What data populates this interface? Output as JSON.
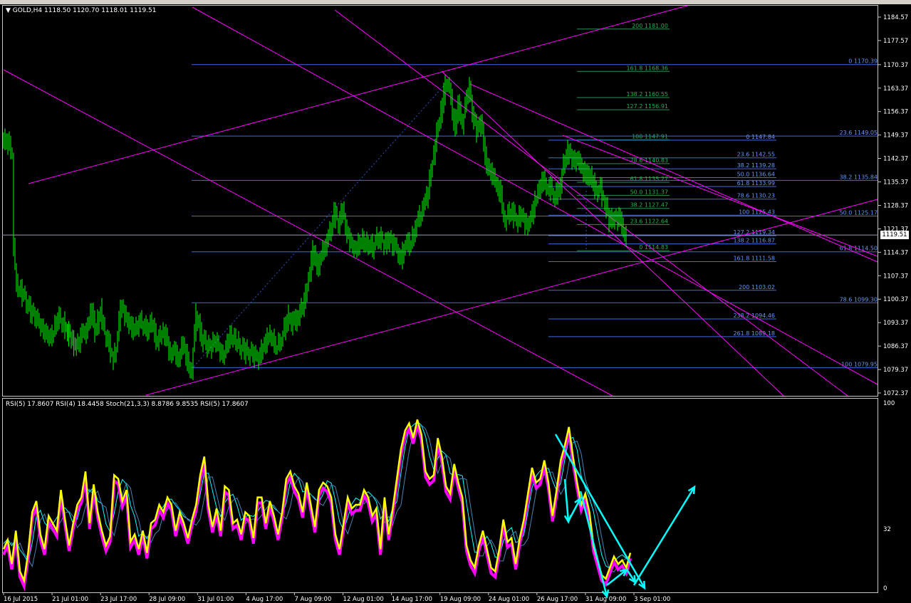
{
  "chart_header": {
    "symbol": "GOLD,H4",
    "ohlc": "1118.50 1120.70 1118.01 1119.51"
  },
  "indicator_header": "RSI(5) 17.8607  RSI(4) 18.4458  Stoch(21,3,3) 8.8786 9.8535  RSI(5) 17.8607",
  "current_price_label": "1119.51",
  "colors": {
    "background": "#000000",
    "candles": "#00ff00",
    "fib_lines": "#4169e1",
    "fib_labels_blue": "#6495ed",
    "fib_labels_green": "#22b14c",
    "trendlines": "#ff00ff",
    "rsi5": "#ff00ff",
    "rsi4": "#ffff00",
    "stoch_main": "#00ffff",
    "arrows": "#00ffff"
  },
  "chart_data": {
    "type": "candlestick",
    "timeframe": "H4",
    "symbol": "GOLD",
    "y_tick_labels": [
      "1184.57",
      "1177.57",
      "1170.37",
      "1163.37",
      "1156.37",
      "1149.37",
      "1142.37",
      "1135.37",
      "1128.37",
      "1121.37",
      "1114.37",
      "1107.37",
      "1100.37",
      "1093.37",
      "1086.37",
      "1079.37",
      "1072.37"
    ],
    "ylim": [
      1072.37,
      1184.57
    ],
    "x_tick_labels": [
      "16 Jul 2015",
      "21 Jul 01:00",
      "23 Jul 17:00",
      "28 Jul 09:00",
      "31 Jul 01:00",
      "4 Aug 17:00",
      "7 Aug 09:00",
      "12 Aug 01:00",
      "14 Aug 17:00",
      "19 Aug 09:00",
      "24 Aug 01:00",
      "26 Aug 17:00",
      "31 Aug 09:00",
      "3 Sep 01:00"
    ],
    "price_path": [
      [
        0,
        1148
      ],
      [
        8,
        1147
      ],
      [
        14,
        1144
      ],
      [
        16,
        1115
      ],
      [
        20,
        1105
      ],
      [
        30,
        1101
      ],
      [
        40,
        1097
      ],
      [
        50,
        1094
      ],
      [
        60,
        1090
      ],
      [
        70,
        1089
      ],
      [
        78,
        1095
      ],
      [
        86,
        1093
      ],
      [
        95,
        1089
      ],
      [
        104,
        1086
      ],
      [
        112,
        1090
      ],
      [
        118,
        1091
      ],
      [
        126,
        1097
      ],
      [
        130,
        1090
      ],
      [
        138,
        1097
      ],
      [
        142,
        1092
      ],
      [
        148,
        1088
      ],
      [
        156,
        1082
      ],
      [
        160,
        1086
      ],
      [
        166,
        1098
      ],
      [
        172,
        1096
      ],
      [
        178,
        1093
      ],
      [
        186,
        1091
      ],
      [
        194,
        1094
      ],
      [
        202,
        1091
      ],
      [
        210,
        1093
      ],
      [
        218,
        1087
      ],
      [
        224,
        1091
      ],
      [
        230,
        1089
      ],
      [
        236,
        1084
      ],
      [
        242,
        1085
      ],
      [
        248,
        1082
      ],
      [
        254,
        1088
      ],
      [
        260,
        1081
      ],
      [
        266,
        1079
      ],
      [
        272,
        1096
      ],
      [
        280,
        1089
      ],
      [
        290,
        1086
      ],
      [
        300,
        1088
      ],
      [
        310,
        1083
      ],
      [
        320,
        1090
      ],
      [
        330,
        1087
      ],
      [
        340,
        1085
      ],
      [
        350,
        1084
      ],
      [
        360,
        1083
      ],
      [
        368,
        1087
      ],
      [
        376,
        1090
      ],
      [
        384,
        1086
      ],
      [
        392,
        1088
      ],
      [
        400,
        1095
      ],
      [
        410,
        1093
      ],
      [
        418,
        1096
      ],
      [
        424,
        1100
      ],
      [
        430,
        1106
      ],
      [
        436,
        1115
      ],
      [
        442,
        1110
      ],
      [
        448,
        1113
      ],
      [
        454,
        1117
      ],
      [
        460,
        1120
      ],
      [
        466,
        1126
      ],
      [
        472,
        1123
      ],
      [
        478,
        1127
      ],
      [
        484,
        1120
      ],
      [
        490,
        1117
      ],
      [
        496,
        1115
      ],
      [
        504,
        1118
      ],
      [
        512,
        1117
      ],
      [
        520,
        1116
      ],
      [
        528,
        1119
      ],
      [
        536,
        1117
      ],
      [
        544,
        1118
      ],
      [
        552,
        1116
      ],
      [
        560,
        1112
      ],
      [
        566,
        1117
      ],
      [
        574,
        1117
      ],
      [
        580,
        1122
      ],
      [
        586,
        1125
      ],
      [
        592,
        1128
      ],
      [
        598,
        1133
      ],
      [
        604,
        1141
      ],
      [
        610,
        1150
      ],
      [
        616,
        1156
      ],
      [
        620,
        1162
      ],
      [
        624,
        1165
      ],
      [
        628,
        1164
      ],
      [
        632,
        1156
      ],
      [
        636,
        1151
      ],
      [
        640,
        1158
      ],
      [
        646,
        1153
      ],
      [
        652,
        1160
      ],
      [
        656,
        1164
      ],
      [
        660,
        1157
      ],
      [
        666,
        1150
      ],
      [
        672,
        1154
      ],
      [
        676,
        1147
      ],
      [
        680,
        1140
      ],
      [
        684,
        1139
      ],
      [
        688,
        1137
      ],
      [
        694,
        1135
      ],
      [
        700,
        1131
      ],
      [
        706,
        1123
      ],
      [
        712,
        1127
      ],
      [
        718,
        1125
      ],
      [
        724,
        1124
      ],
      [
        730,
        1126
      ],
      [
        736,
        1122
      ],
      [
        740,
        1123
      ],
      [
        746,
        1128
      ],
      [
        752,
        1132
      ],
      [
        758,
        1136
      ],
      [
        764,
        1134
      ],
      [
        770,
        1133
      ],
      [
        776,
        1131
      ],
      [
        782,
        1133
      ],
      [
        788,
        1140
      ],
      [
        794,
        1145
      ],
      [
        800,
        1142
      ],
      [
        806,
        1142
      ],
      [
        812,
        1141
      ],
      [
        818,
        1137
      ],
      [
        824,
        1138
      ],
      [
        828,
        1135
      ],
      [
        834,
        1133
      ],
      [
        840,
        1133
      ],
      [
        846,
        1129
      ],
      [
        852,
        1124
      ],
      [
        856,
        1125
      ],
      [
        862,
        1124
      ],
      [
        868,
        1125
      ],
      [
        872,
        1120
      ],
      [
        876,
        1119
      ]
    ],
    "fib_levels": [
      {
        "label": "200 1181.00",
        "price": 1181.0,
        "color": "green"
      },
      {
        "label": "161.8 1168.36",
        "price": 1168.36,
        "color": "green"
      },
      {
        "label": "138.2 1160.55",
        "price": 1160.55,
        "color": "green"
      },
      {
        "label": "127.2 1156.91",
        "price": 1156.91,
        "color": "green"
      },
      {
        "label": "100 1147.91",
        "price": 1147.91,
        "color": "green"
      },
      {
        "label": "78.6 1140.83",
        "price": 1140.83,
        "color": "green"
      },
      {
        "label": "61.8 1135.27",
        "price": 1135.27,
        "color": "green"
      },
      {
        "label": "50.0 1131.37",
        "price": 1131.37,
        "color": "green"
      },
      {
        "label": "38.2 1127.47",
        "price": 1127.47,
        "color": "green"
      },
      {
        "label": "23.6 1122.64",
        "price": 1122.64,
        "color": "green"
      },
      {
        "label": "0 1114.83",
        "price": 1114.83,
        "color": "green"
      },
      {
        "label": "0 1170.39",
        "price": 1170.39,
        "color": "blue"
      },
      {
        "label": "23.6 1149.05",
        "price": 1149.05,
        "color": "blue"
      },
      {
        "label": "38.2 1135.84",
        "price": 1135.84,
        "color": "blue"
      },
      {
        "label": "50.0 1125.17",
        "price": 1125.17,
        "color": "blue"
      },
      {
        "label": "61.8 1114.50",
        "price": 1114.5,
        "color": "blue"
      },
      {
        "label": "78.6 1099.30",
        "price": 1099.3,
        "color": "blue"
      },
      {
        "label": "100 1079.95",
        "price": 1079.95,
        "color": "blue"
      },
      {
        "label": "0 1147.84",
        "price": 1147.84,
        "color": "blue"
      },
      {
        "label": "23.6 1142.55",
        "price": 1142.55,
        "color": "blue"
      },
      {
        "label": "38.2 1139.28",
        "price": 1139.28,
        "color": "blue"
      },
      {
        "label": "50.0 1136.64",
        "price": 1136.64,
        "color": "blue"
      },
      {
        "label": "61.8 1133.99",
        "price": 1133.99,
        "color": "blue"
      },
      {
        "label": "78.6 1130.23",
        "price": 1130.23,
        "color": "blue"
      },
      {
        "label": "100 1125.43",
        "price": 1125.43,
        "color": "blue"
      },
      {
        "label": "127.2 1119.34",
        "price": 1119.34,
        "color": "blue"
      },
      {
        "label": "138.2 1116.87",
        "price": 1116.87,
        "color": "blue"
      },
      {
        "label": "161.8 1111.58",
        "price": 1111.58,
        "color": "blue"
      },
      {
        "label": "200 1103.02",
        "price": 1103.02,
        "color": "blue"
      },
      {
        "label": "238.2 1094.46",
        "price": 1094.46,
        "color": "blue"
      },
      {
        "label": "261.8 1089.18",
        "price": 1089.18,
        "color": "blue"
      }
    ],
    "indicator": {
      "y_tick_labels": [
        "100",
        "32",
        "0"
      ],
      "ylim": [
        0,
        100
      ],
      "series": [
        {
          "name": "RSI(5)",
          "color": "#ff00ff"
        },
        {
          "name": "RSI(4)",
          "color": "#ffff00"
        },
        {
          "name": "Stoch(21,3,3)",
          "color": "#00ffff"
        }
      ],
      "rsi_values": [
        20,
        25,
        12,
        30,
        8,
        3,
        18,
        40,
        46,
        28,
        20,
        38,
        34,
        30,
        52,
        36,
        22,
        34,
        44,
        48,
        62,
        34,
        55,
        40,
        30,
        22,
        27,
        60,
        58,
        46,
        52,
        24,
        28,
        20,
        30,
        18,
        34,
        36,
        44,
        40,
        48,
        44,
        30,
        40,
        34,
        26,
        36,
        44,
        60,
        70,
        44,
        32,
        42,
        30,
        54,
        52,
        34,
        36,
        28,
        40,
        38,
        26,
        48,
        48,
        34,
        46,
        38,
        28,
        40,
        58,
        62,
        54,
        50,
        40,
        56,
        44,
        32,
        52,
        56,
        54,
        48,
        28,
        20,
        34,
        48,
        42,
        44,
        44,
        52,
        48,
        38,
        42,
        20,
        48,
        28,
        42,
        58,
        74,
        84,
        88,
        80,
        90,
        82,
        62,
        58,
        60,
        80,
        70,
        54,
        50,
        66,
        56,
        48,
        22,
        14,
        10,
        22,
        30,
        20,
        10,
        8,
        20,
        36,
        24,
        26,
        12,
        26,
        36,
        50,
        64,
        56,
        58,
        68,
        56,
        38,
        52,
        68,
        76,
        86,
        70,
        56,
        44,
        50,
        40,
        22,
        14,
        6,
        4,
        10,
        16,
        12,
        14,
        10,
        18
      ]
    }
  }
}
